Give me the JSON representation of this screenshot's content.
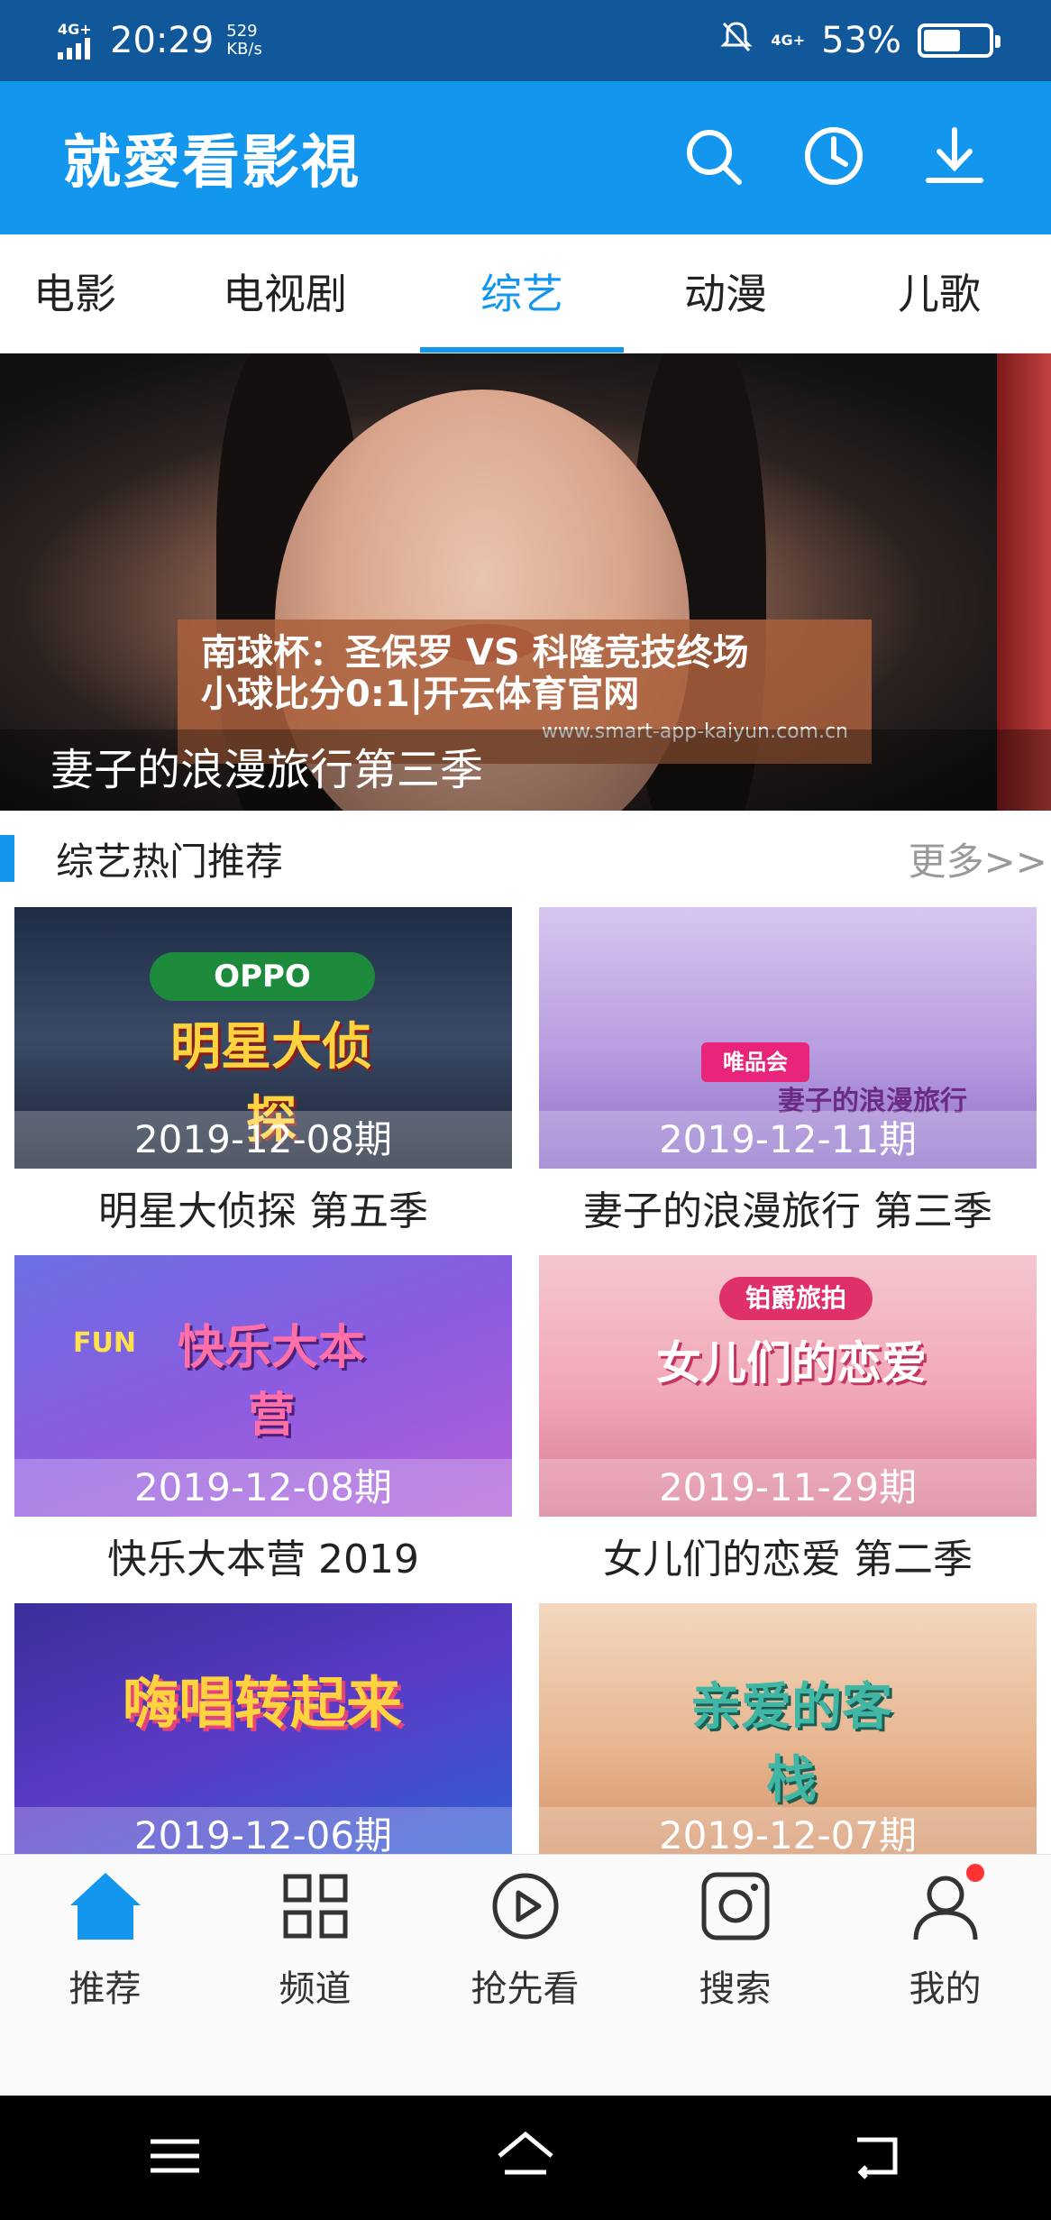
{
  "status_bar": {
    "network": "4G+",
    "time": "20:29",
    "speed_value": "529",
    "speed_unit": "KB/s",
    "network_right": "4G+",
    "battery_text": "53%",
    "battery_level": 0.53
  },
  "header": {
    "title": "就愛看影視",
    "icons": [
      "search-icon",
      "history-icon",
      "download-icon"
    ]
  },
  "tabs": [
    {
      "label": "电影",
      "active": false
    },
    {
      "label": "电视剧",
      "active": false
    },
    {
      "label": "综艺",
      "active": true
    },
    {
      "label": "动漫",
      "active": false
    },
    {
      "label": "儿歌",
      "active": false
    }
  ],
  "banner": {
    "caption": "妻子的浪漫旅行第三季",
    "ad_line1": "南球杯：圣保罗 VS 科隆竞技终场",
    "ad_line2": "小球比分0:1|开云体育官网",
    "ad_url": "www.smart-app-kaiyun.com.cn"
  },
  "section": {
    "title": "综艺热门推荐",
    "more": "更多>>"
  },
  "cards": [
    {
      "date": "2019-12-08期",
      "title": "明星大侦探 第五季",
      "art": "明星大侦探",
      "logo": "OPPO"
    },
    {
      "date": "2019-12-11期",
      "title": "妻子的浪漫旅行 第三季",
      "art": "妻子的浪漫旅行",
      "logo": "唯品会"
    },
    {
      "date": "2019-12-08期",
      "title": "快乐大本营 2019",
      "art": "快乐大本营",
      "logo": "FUN"
    },
    {
      "date": "2019-11-29期",
      "title": "女儿们的恋爱 第二季",
      "art": "女儿们的恋爱",
      "logo": "铂爵旅拍"
    },
    {
      "date": "2019-12-06期",
      "title": "",
      "art": "嗨唱转起来",
      "logo": ""
    },
    {
      "date": "2019-12-07期",
      "title": "",
      "art": "亲爱的客栈",
      "logo": ""
    }
  ],
  "bottom_nav": [
    {
      "label": "推荐",
      "icon": "home-icon",
      "active": true
    },
    {
      "label": "频道",
      "icon": "grid-icon",
      "active": false
    },
    {
      "label": "抢先看",
      "icon": "play-icon",
      "active": false
    },
    {
      "label": "搜索",
      "icon": "camera-icon",
      "active": false
    },
    {
      "label": "我的",
      "icon": "profile-icon",
      "active": false,
      "badge": true
    }
  ],
  "system_nav": [
    "menu-icon",
    "home-icon",
    "back-icon"
  ]
}
